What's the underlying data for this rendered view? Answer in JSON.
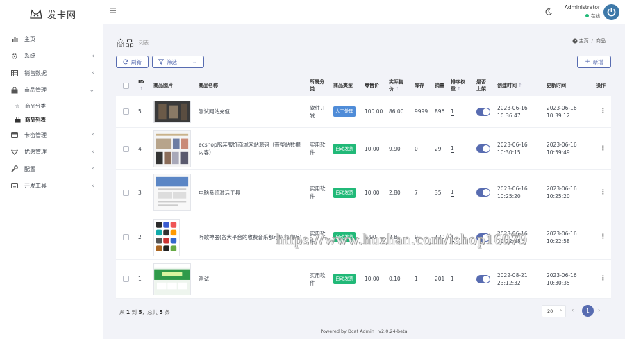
{
  "app": {
    "logo_text": "发卡网"
  },
  "sidebar": {
    "items": [
      {
        "label": "主页",
        "icon": "bar-chart-icon",
        "has_arrow": false
      },
      {
        "label": "系统",
        "icon": "gear-icon",
        "has_arrow": true
      },
      {
        "label": "销售数据",
        "icon": "table-icon",
        "has_arrow": true
      },
      {
        "label": "商品管理",
        "icon": "shopping-bag-icon",
        "has_arrow": true,
        "expanded": true
      },
      {
        "label": "卡密管理",
        "icon": "credit-card-icon",
        "has_arrow": true
      },
      {
        "label": "优惠管理",
        "icon": "diamond-icon",
        "has_arrow": true
      },
      {
        "label": "配置",
        "icon": "wrench-icon",
        "has_arrow": true
      },
      {
        "label": "开发工具",
        "icon": "keyboard-icon",
        "has_arrow": true
      }
    ],
    "sub_items": [
      {
        "label": "商品分类",
        "icon": "star-icon"
      },
      {
        "label": "商品列表",
        "icon": "shopping-bag-icon",
        "active": true
      }
    ]
  },
  "navbar": {
    "user_name": "Administrator",
    "user_status": "在线"
  },
  "page": {
    "title": "商品",
    "subtitle": "列表",
    "breadcrumb": [
      "主页",
      "商品"
    ]
  },
  "toolbar": {
    "refresh_label": "刷新",
    "filter_label": "筛选",
    "new_label": "新增"
  },
  "table": {
    "headers": {
      "id": "ID",
      "image": "商品图片",
      "name": "商品名称",
      "category_line1": "所属分",
      "category_line2": "类",
      "type": "商品类型",
      "wholesale": "零售价",
      "price_line1": "实际售",
      "price_line2": "价",
      "stock": "库存",
      "sales": "销量",
      "weight_line1": "排序权",
      "weight_line2": "重",
      "listed_line1": "是否",
      "listed_line2": "上架",
      "created": "创建时间",
      "updated": "更新时间",
      "actions": "操作"
    },
    "rows": [
      {
        "id": "5",
        "name": "测试网站充值",
        "category_line1": "软件开",
        "category_line2": "发",
        "type": "人工处理",
        "type_color": "blue",
        "retail": "100.00",
        "price": "86.00",
        "stock": "9999",
        "sales": "896",
        "weight": "1",
        "listed": true,
        "created_date": "2023-06-16",
        "created_time": "10:36:47",
        "updated_date": "2023-06-16",
        "updated_time": "10:39:12"
      },
      {
        "id": "4",
        "name": "ecshop服装服饰商城网站源码（带整站数据内容）",
        "category_line1": "实用软",
        "category_line2": "件",
        "type": "自动发货",
        "type_color": "green",
        "retail": "10.00",
        "price": "9.90",
        "stock": "0",
        "sales": "29",
        "weight": "1",
        "listed": true,
        "created_date": "2023-06-16",
        "created_time": "10:30:15",
        "updated_date": "2023-06-16",
        "updated_time": "10:59:49"
      },
      {
        "id": "3",
        "name": "电脑系统激活工具",
        "category_line1": "实用软",
        "category_line2": "件",
        "type": "自动发货",
        "type_color": "green",
        "retail": "10.00",
        "price": "2.80",
        "stock": "7",
        "sales": "35",
        "weight": "1",
        "listed": true,
        "created_date": "2023-06-16",
        "created_time": "10:25:20",
        "updated_date": "2023-06-16",
        "updated_time": "10:25:20"
      },
      {
        "id": "2",
        "name": "听歌神器(各大平台的收费音乐都可以免费听)",
        "category_line1": "实用软",
        "category_line2": "件",
        "type": "自动发货",
        "type_color": "green",
        "retail": "9.90",
        "price": "2.8",
        "stock": "9",
        "sales": "120",
        "weight": "1",
        "listed": true,
        "created_date": "2023-06-16",
        "created_time": "10:22:58",
        "updated_date": "2023-06-16",
        "updated_time": "10:22:58"
      },
      {
        "id": "1",
        "name": "测试",
        "category_line1": "实用软",
        "category_line2": "件",
        "type": "自动发货",
        "type_color": "green",
        "retail": "10.00",
        "price": "0.10",
        "stock": "1",
        "sales": "201",
        "weight": "1",
        "listed": true,
        "created_date": "2022-08-21",
        "created_time": "23:12:32",
        "updated_date": "2023-06-16",
        "updated_time": "10:30:35"
      }
    ]
  },
  "pagination": {
    "info_prefix": "从",
    "from": "1",
    "to_word": "到",
    "to": "5",
    "total_word": "，总共",
    "total": "5",
    "unit": "条",
    "per_page": "20",
    "current_page": "1"
  },
  "footer": {
    "text": "Powered by Dcat Admin · v2.0.24-beta"
  },
  "watermark": {
    "text": "https://www.huzhan.com/ishop16079"
  },
  "colors": {
    "primary": "#586cb1",
    "success": "#21b978",
    "info": "#4f8cd8",
    "avatar": "#3e79a9"
  }
}
